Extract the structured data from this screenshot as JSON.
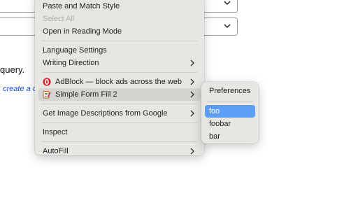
{
  "page": {
    "text_fragment": "query.",
    "link_fragment": "create a c"
  },
  "context_menu": {
    "items": [
      {
        "label": "Paste and Match Style"
      },
      {
        "label": "Select All"
      },
      {
        "label": "Open in Reading Mode"
      },
      {
        "label": "Language Settings"
      },
      {
        "label": "Writing Direction"
      },
      {
        "label": "AdBlock — block ads across the web"
      },
      {
        "label": "Simple Form Fill 2"
      },
      {
        "label": "Get Image Descriptions from Google"
      },
      {
        "label": "Inspect"
      },
      {
        "label": "AutoFill"
      }
    ]
  },
  "submenu": {
    "items": [
      {
        "label": "Preferences"
      },
      {
        "label": "foo"
      },
      {
        "label": "foobar"
      },
      {
        "label": "bar"
      }
    ],
    "selected": "foo"
  },
  "icons": {
    "submenu_arrow": "chevron-right-icon",
    "adblock": "adblock-icon",
    "form_fill": "form-fill-icon",
    "dropdown": "chevron-down-icon"
  },
  "colors": {
    "menu_background": "#e8e6e3",
    "hover": "#d6d4d1",
    "selected": "#5c9ef8",
    "link": "#1a4fd6",
    "adblock_red": "#d7262a"
  }
}
